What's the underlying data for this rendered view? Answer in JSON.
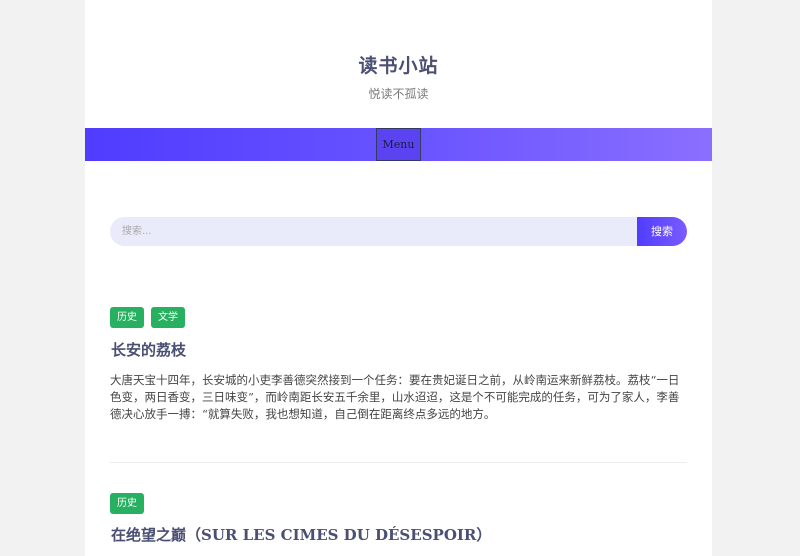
{
  "site": {
    "title": "读书小站",
    "tagline": "悦读不孤读"
  },
  "nav": {
    "menu_label": "Menu"
  },
  "search": {
    "placeholder": "搜索...",
    "button_label": "搜索"
  },
  "posts": [
    {
      "tags": [
        "历史",
        "文学"
      ],
      "title": "长安的荔枝",
      "excerpt": "大唐天宝十四年，长安城的小吏李善德突然接到一个任务：要在贵妃诞日之前，从岭南运来新鲜荔枝。荔枝“一日色变，两日香变，三日味变”，而岭南距长安五千余里，山水迢迢，这是个不可能完成的任务，可为了家人，李善德决心放手一搏：“就算失败，我也想知道，自己倒在距离终点多远的地方。"
    },
    {
      "tags": [
        "历史"
      ],
      "title": "在绝望之巅（SUR LES CIMES DU DÉSESPOIR）"
    }
  ],
  "colors": {
    "nav_gradient_start": "#4f3cff",
    "nav_gradient_end": "#8a6fff",
    "tag_green": "#27b05f",
    "title_color": "#4a4f73"
  }
}
